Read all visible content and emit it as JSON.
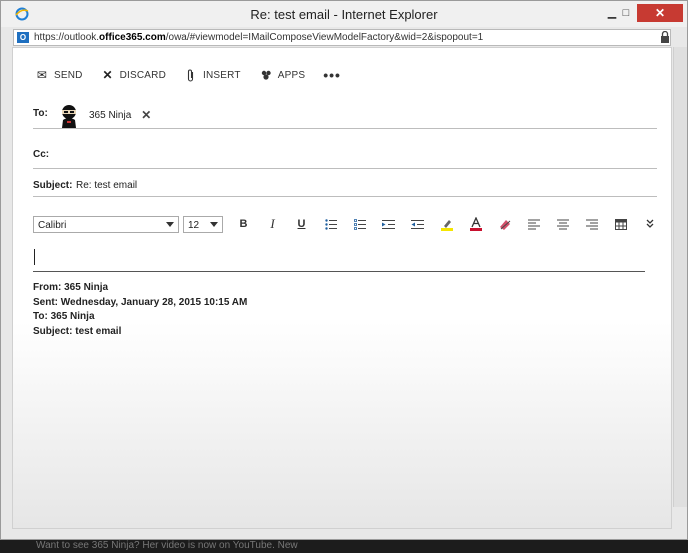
{
  "window": {
    "title": "Re: test email - Internet Explorer",
    "minimize_glyph": "▁",
    "maximize_glyph": "□",
    "close_glyph": "✕"
  },
  "address": {
    "prefix": "https://outlook.",
    "domain": "office365.com",
    "path": "/owa/#viewmodel=IMailComposeViewModelFactory&wid=2&ispopout=1"
  },
  "toolbar": {
    "send": "SEND",
    "discard": "DISCARD",
    "insert": "INSERT",
    "apps": "APPS",
    "more": "•••"
  },
  "compose": {
    "to_label": "To:",
    "recipient": "365 Ninja",
    "cc_label": "Cc:",
    "subject_label": "Subject:",
    "subject_value": "Re: test email"
  },
  "format": {
    "font": "Calibri",
    "size": "12",
    "bold": "B",
    "italic": "I",
    "underline": "U"
  },
  "quoted": {
    "from_label": "From:",
    "from_value": "365 Ninja",
    "sent_label": "Sent:",
    "sent_value": "Wednesday, January 28, 2015 10:15 AM",
    "to_label": "To:",
    "to_value": "365 Ninja",
    "subject_label": "Subject:",
    "subject_value": "test email"
  },
  "background_text": "Want to see 365 Ninja? Her video is now on YouTube. New"
}
